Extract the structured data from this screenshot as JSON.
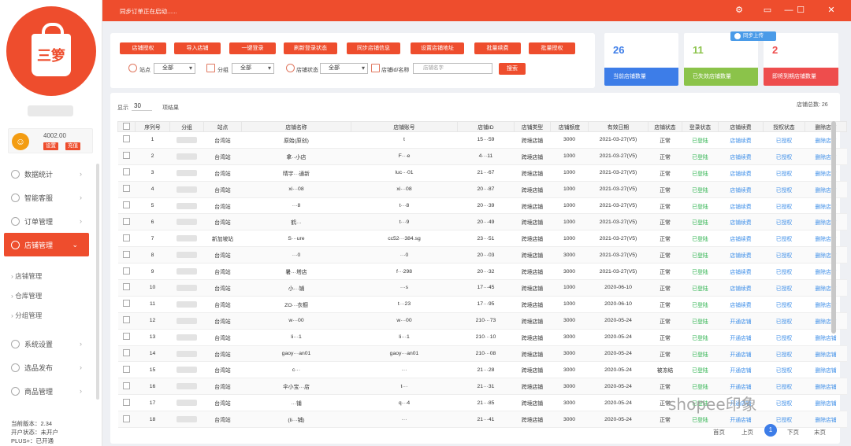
{
  "sidebar": {
    "logo_text": "三箩",
    "account": {
      "amount": "4002.00",
      "btn_recharge": "设置",
      "btn_exit": "充值"
    },
    "menu": [
      {
        "label": "数据统计",
        "icon": "chart-icon"
      },
      {
        "label": "智能客服",
        "icon": "service-icon"
      },
      {
        "label": "订单管理",
        "icon": "order-icon"
      },
      {
        "label": "店铺管理",
        "icon": "shop-icon",
        "active": true
      }
    ],
    "submenu": [
      "店铺管理",
      "仓库管理",
      "分组管理"
    ],
    "menu2": [
      {
        "label": "系统设置",
        "icon": "gear-icon"
      },
      {
        "label": "选品发布",
        "icon": "publish-icon"
      },
      {
        "label": "商品管理",
        "icon": "goods-icon"
      }
    ],
    "footer": {
      "version": "当前版本：2.34",
      "status": "开户状态：未开户",
      "plus": "PLUS+：已开通"
    }
  },
  "topbar": {
    "message": "同步订单正在启动......"
  },
  "toolbar": {
    "buttons": [
      "店铺授权",
      "导入店铺",
      "一键登录",
      "刷新登录状态",
      "同步店铺信息",
      "设置店铺地址",
      "批量续费",
      "批量授权"
    ],
    "filters": {
      "site_label": "站点",
      "site_value": "全部",
      "group_label": "分组",
      "group_value": "全部",
      "status_label": "店铺状态",
      "status_value": "全部",
      "keyword_label": "店铺id/名称",
      "keyword_placeholder": "店铺名字",
      "search_label": "搜索"
    }
  },
  "stats": [
    {
      "value": "26",
      "label": "当前店铺数量",
      "color": "#3d7de8"
    },
    {
      "value": "11",
      "label": "已失效店铺数量",
      "color": "#8bc34a"
    },
    {
      "value": "2",
      "label": "即将到期店铺数量",
      "color": "#ee4d4d"
    }
  ],
  "upload_pill": "同步上传",
  "table": {
    "show_label": "显示",
    "page_size": "30",
    "per_page_label": "项结果",
    "total_label": "店铺总数: 26",
    "columns": [
      "",
      "序列号",
      "分组",
      "站点",
      "店铺名称",
      "店铺账号",
      "店铺ID",
      "店铺类型",
      "店铺额度",
      "有效日期",
      "店铺状态",
      "登录状态",
      "店铺续费",
      "授权状态",
      "删除店铺"
    ],
    "rows": [
      {
        "no": "1",
        "group": "",
        "site": "台湾站",
        "name": "原始(原创)",
        "account": "t",
        "id": "15···59",
        "type": "跨境店铺",
        "quota": "3000",
        "date": "2021-03-27(V5)",
        "status": "正常",
        "login": "已登陆",
        "renew": "店铺续费",
        "auth": "已授权",
        "del": "删除店铺"
      },
      {
        "no": "2",
        "group": "",
        "site": "台湾站",
        "name": "拿··小店",
        "account": "F···e",
        "id": "4···11",
        "type": "跨境店铺",
        "quota": "1000",
        "date": "2021-03-27(V5)",
        "status": "正常",
        "login": "已登陆",
        "renew": "店铺续费",
        "auth": "已授权",
        "del": "删除店铺"
      },
      {
        "no": "3",
        "group": "",
        "site": "台湾站",
        "name": "晴宇···通新",
        "account": "luc···01",
        "id": "21···67",
        "type": "跨境店铺",
        "quota": "1000",
        "date": "2021-03-27(V5)",
        "status": "正常",
        "login": "已登陆",
        "renew": "店铺续费",
        "auth": "已授权",
        "del": "删除店铺"
      },
      {
        "no": "4",
        "group": "",
        "site": "台湾站",
        "name": "xi···08",
        "account": "xi···08",
        "id": "20···87",
        "type": "跨境店铺",
        "quota": "1000",
        "date": "2021-03-27(V5)",
        "status": "正常",
        "login": "已登陆",
        "renew": "店铺续费",
        "auth": "已授权",
        "del": "删除店铺"
      },
      {
        "no": "5",
        "group": "",
        "site": "台湾站",
        "name": "···8",
        "account": "t···8",
        "id": "20···39",
        "type": "跨境店铺",
        "quota": "1000",
        "date": "2021-03-27(V5)",
        "status": "正常",
        "login": "已登陆",
        "renew": "店铺续费",
        "auth": "已授权",
        "del": "删除店铺"
      },
      {
        "no": "6",
        "group": "",
        "site": "台湾站",
        "name": "鹤···",
        "account": "t···9",
        "id": "20···49",
        "type": "跨境店铺",
        "quota": "1000",
        "date": "2021-03-27(V5)",
        "status": "正常",
        "login": "已登陆",
        "renew": "店铺续费",
        "auth": "已授权",
        "del": "删除店铺"
      },
      {
        "no": "7",
        "group": "",
        "site": "新加坡站",
        "name": "S···ure",
        "account": "cc52···384.sg",
        "id": "23···51",
        "type": "跨境店铺",
        "quota": "1000",
        "date": "2021-03-27(V5)",
        "status": "正常",
        "login": "已登陆",
        "renew": "店铺续费",
        "auth": "已授权",
        "del": "删除店铺"
      },
      {
        "no": "8",
        "group": "",
        "site": "台湾站",
        "name": "···0",
        "account": "···0",
        "id": "20···03",
        "type": "跨境店铺",
        "quota": "3000",
        "date": "2021-03-27(V5)",
        "status": "正常",
        "login": "已登陆",
        "renew": "店铺续费",
        "auth": "已授权",
        "del": "删除店铺"
      },
      {
        "no": "9",
        "group": "",
        "site": "台湾站",
        "name": "暑···塔店",
        "account": "f···298",
        "id": "20···32",
        "type": "跨境店铺",
        "quota": "3000",
        "date": "2021-03-27(V5)",
        "status": "正常",
        "login": "已登陆",
        "renew": "店铺续费",
        "auth": "已授权",
        "del": "删除店铺"
      },
      {
        "no": "10",
        "group": "",
        "site": "台湾站",
        "name": "小···铺",
        "account": "···s",
        "id": "17···45",
        "type": "跨境店铺",
        "quota": "1000",
        "date": "2020-06-10",
        "status": "正常",
        "login": "已登陆",
        "renew": "店铺续费",
        "auth": "已授权",
        "del": "删除店铺"
      },
      {
        "no": "11",
        "group": "",
        "site": "台湾站",
        "name": "ZO···衣橱",
        "account": "t···23",
        "id": "17···95",
        "type": "跨境店铺",
        "quota": "1000",
        "date": "2020-06-10",
        "status": "正常",
        "login": "已登陆",
        "renew": "店铺续费",
        "auth": "已授权",
        "del": "删除店铺"
      },
      {
        "no": "12",
        "group": "",
        "site": "台湾站",
        "name": "w···00",
        "account": "w···00",
        "id": "210···73",
        "type": "跨境店铺",
        "quota": "3000",
        "date": "2020-05-24",
        "status": "正常",
        "login": "已登陆",
        "renew": "开通店铺",
        "auth": "已授权",
        "del": "删除店铺"
      },
      {
        "no": "13",
        "group": "",
        "site": "台湾站",
        "name": "li···1",
        "account": "li···1",
        "id": "210···10",
        "type": "跨境店铺",
        "quota": "3000",
        "date": "2020-05-24",
        "status": "正常",
        "login": "已登陆",
        "renew": "开通店铺",
        "auth": "已授权",
        "del": "删除店铺"
      },
      {
        "no": "14",
        "group": "",
        "site": "台湾站",
        "name": "gaoy···an01",
        "account": "gaoy···an01",
        "id": "210···08",
        "type": "跨境店铺",
        "quota": "3000",
        "date": "2020-05-24",
        "status": "正常",
        "login": "已登陆",
        "renew": "开通店铺",
        "auth": "已授权",
        "del": "删除店铺"
      },
      {
        "no": "15",
        "group": "",
        "site": "台湾站",
        "name": "c···",
        "account": "···",
        "id": "21···28",
        "type": "跨境店铺",
        "quota": "3000",
        "date": "2020-05-24",
        "status": "被冻结",
        "login": "已登陆",
        "renew": "开通店铺",
        "auth": "已授权",
        "del": "删除店铺"
      },
      {
        "no": "16",
        "group": "",
        "site": "台湾站",
        "name": "伞小宝···店",
        "account": "t···",
        "id": "21···31",
        "type": "跨境店铺",
        "quota": "3000",
        "date": "2020-05-24",
        "status": "正常",
        "login": "已登陆",
        "renew": "开通店铺",
        "auth": "已授权",
        "del": "删除店铺"
      },
      {
        "no": "17",
        "group": "",
        "site": "台湾站",
        "name": "···铺",
        "account": "q···4",
        "id": "21···85",
        "type": "跨境店铺",
        "quota": "3000",
        "date": "2020-05-24",
        "status": "正常",
        "login": "已登陆",
        "renew": "开通店铺",
        "auth": "已授权",
        "del": "删除店铺"
      },
      {
        "no": "18",
        "group": "",
        "site": "台湾站",
        "name": "(li···铺)",
        "account": "···",
        "id": "21···41",
        "type": "跨境店铺",
        "quota": "3000",
        "date": "2020-05-24",
        "status": "正常",
        "login": "已登陆",
        "renew": "开通店铺",
        "auth": "已授权",
        "del": "删除店铺"
      }
    ]
  },
  "pager": {
    "first": "首页",
    "prev": "上页",
    "current": "1",
    "next": "下页",
    "last": "末页"
  },
  "watermark": "shopee印象"
}
